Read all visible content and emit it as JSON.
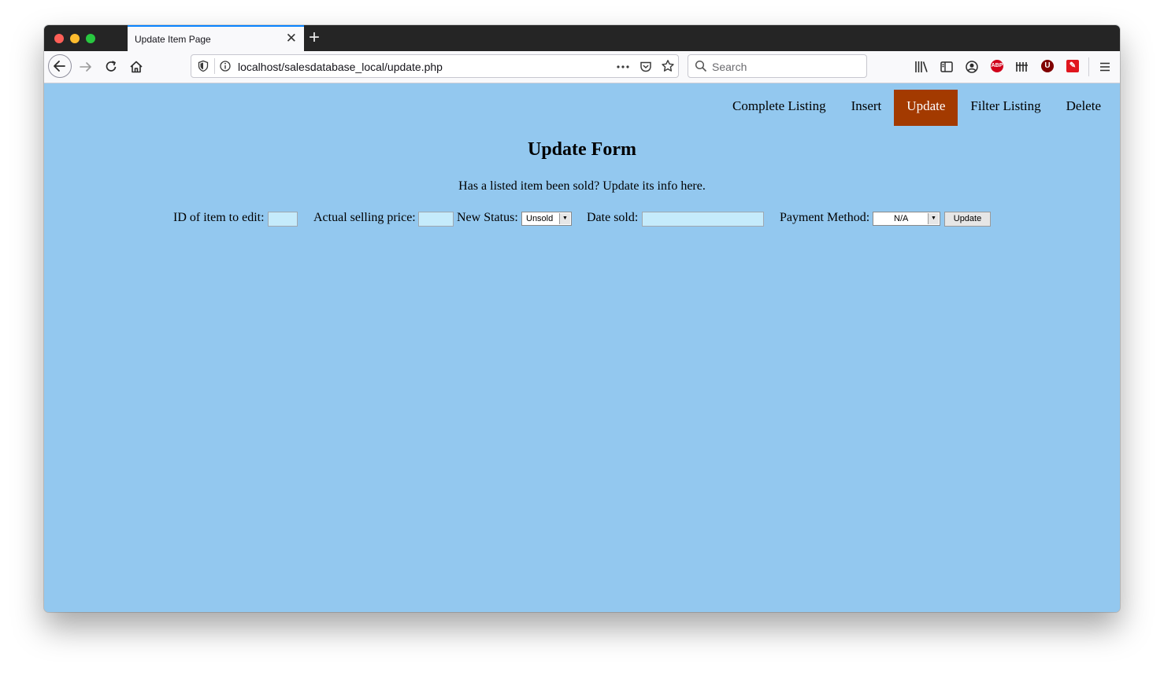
{
  "browser": {
    "tab_title": "Update Item Page",
    "new_tab_label": "+",
    "url": "localhost/salesdatabase_local/update.php",
    "search_placeholder": "Search"
  },
  "nav": {
    "items": [
      {
        "label": "Complete Listing",
        "active": false
      },
      {
        "label": "Insert",
        "active": false
      },
      {
        "label": "Update",
        "active": true
      },
      {
        "label": "Filter Listing",
        "active": false
      },
      {
        "label": "Delete",
        "active": false
      }
    ]
  },
  "page": {
    "title": "Update Form",
    "subtitle": "Has a listed item been sold? Update its info here."
  },
  "form": {
    "id_label": "ID of item to edit:",
    "id_value": "",
    "price_label": "Actual selling price:",
    "price_value": "",
    "status_label": "New Status:",
    "status_value": "Unsold",
    "date_label": "Date sold:",
    "date_value": "",
    "payment_label": "Payment Method:",
    "payment_value": "N/A",
    "submit_label": "Update"
  },
  "colors": {
    "page_bg": "#93c8ef",
    "active_nav_bg": "#a33a00",
    "input_bg": "#c5ebfb"
  }
}
